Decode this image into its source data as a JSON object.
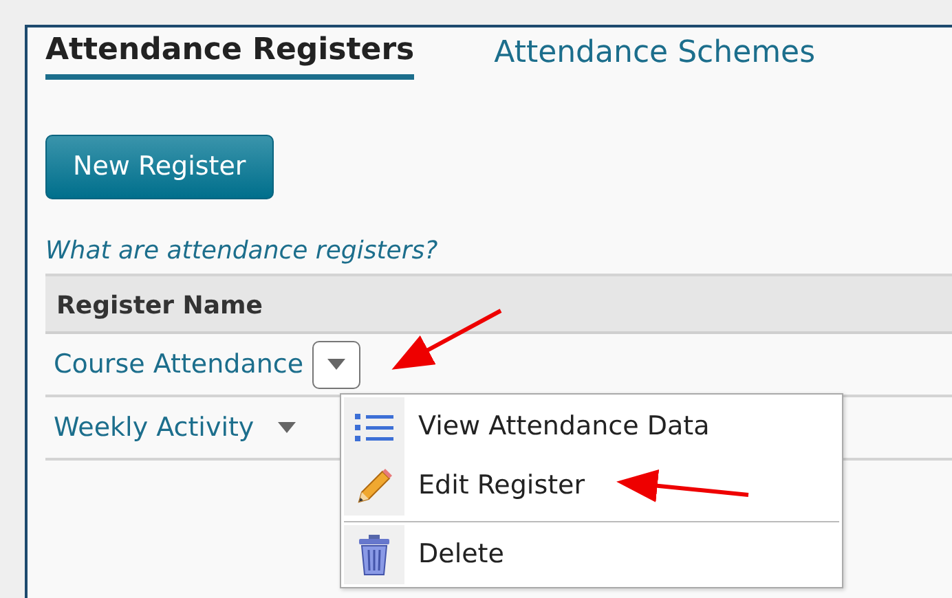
{
  "tabs": [
    {
      "label": "Attendance Registers",
      "selected": true
    },
    {
      "label": "Attendance Schemes",
      "selected": false
    }
  ],
  "new_button": "New Register",
  "help_link": "What are attendance registers?",
  "table": {
    "columns": [
      "Register Name"
    ],
    "rows": [
      {
        "name": "Course Attendance",
        "menu_open": true
      },
      {
        "name": "Weekly Activity",
        "menu_open": false
      }
    ]
  },
  "context_menu": {
    "items": [
      {
        "kind": "list",
        "label": "View Attendance Data",
        "divider_before": false
      },
      {
        "kind": "pencil",
        "label": "Edit Register",
        "divider_before": false
      },
      {
        "kind": "trash",
        "label": "Delete",
        "divider_before": true
      }
    ]
  }
}
